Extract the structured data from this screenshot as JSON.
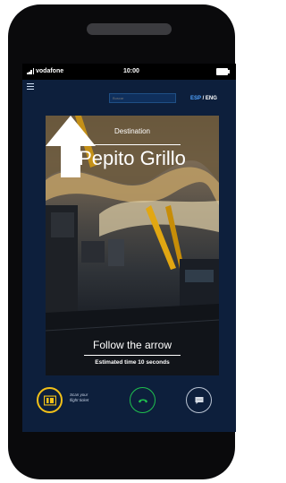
{
  "status_bar": {
    "carrier": "vodafone",
    "time": "10:00",
    "signal_icon": "signal-bars-icon",
    "battery_icon": "battery-full-icon"
  },
  "header": {
    "menu_icon": "hamburger-menu-icon",
    "search": {
      "placeholder": "Buscar",
      "value": ""
    },
    "language": {
      "esp": "ESP",
      "separator": "/",
      "eng": "ENG",
      "active": "ESP"
    }
  },
  "card": {
    "background": "airport-terminal-photo",
    "destination_label": "Destination",
    "destination_name": "Pepito Grillo",
    "arrow_icon": "up-arrow-icon",
    "follow_text": "Follow the arrow",
    "estimate_text": "Estimated time 10 seconds"
  },
  "bottom_bar": {
    "ticket_icon": "ticket-scan-icon",
    "scan_line1": "Scan your",
    "scan_line2": "flight ticket",
    "call_icon": "phone-hangup-icon",
    "chat_icon": "chat-bubble-icon"
  },
  "colors": {
    "screen_bg": "#0d1f3c",
    "accent_blue": "#4fa3ff",
    "ticket_yellow": "#f2c018",
    "call_green": "#1fbf4e"
  }
}
